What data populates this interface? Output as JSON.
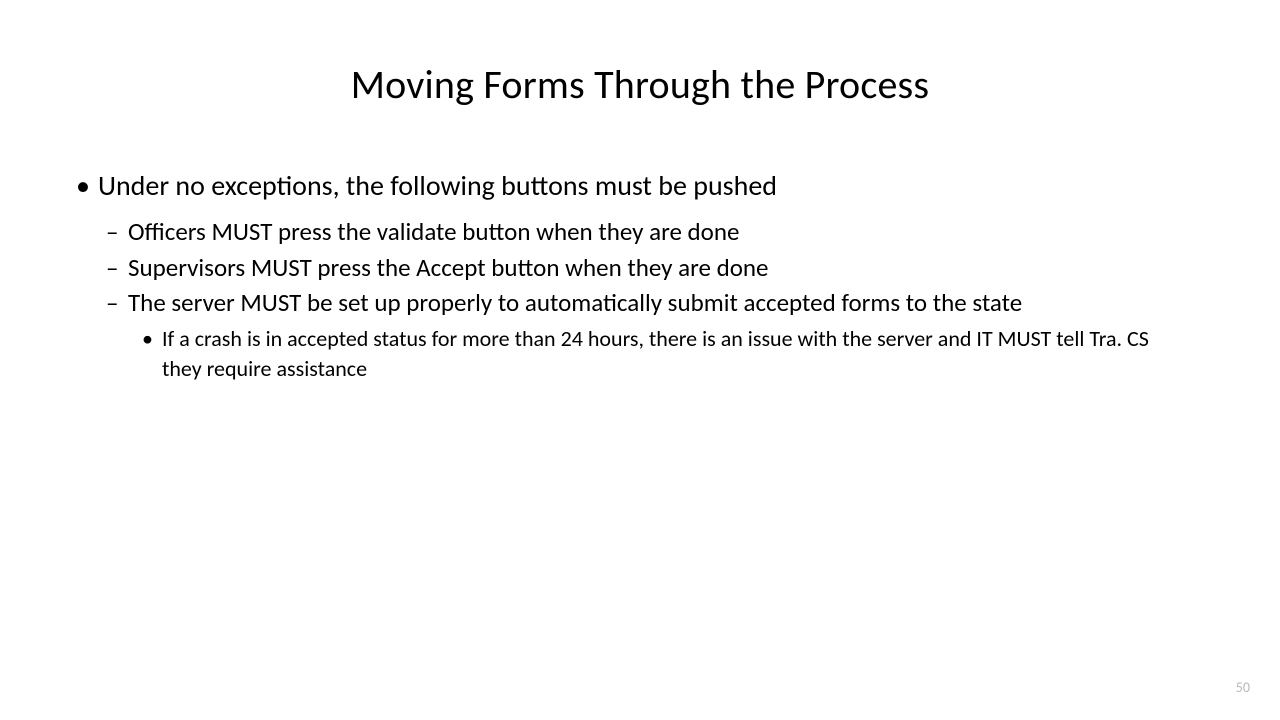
{
  "title": "Moving Forms Through the Process",
  "bullets": {
    "l1": "Under no exceptions, the following buttons must be pushed",
    "l2a": "Officers MUST press the validate button when they are done",
    "l2b": "Supervisors MUST press the Accept button when they are done",
    "l2c": "The server MUST be set up properly to automatically submit accepted forms to the state",
    "l3a": "If a crash is in accepted status for more than 24 hours, there is an issue with the server and IT MUST tell Tra. CS they require assistance"
  },
  "pageNumber": "50"
}
